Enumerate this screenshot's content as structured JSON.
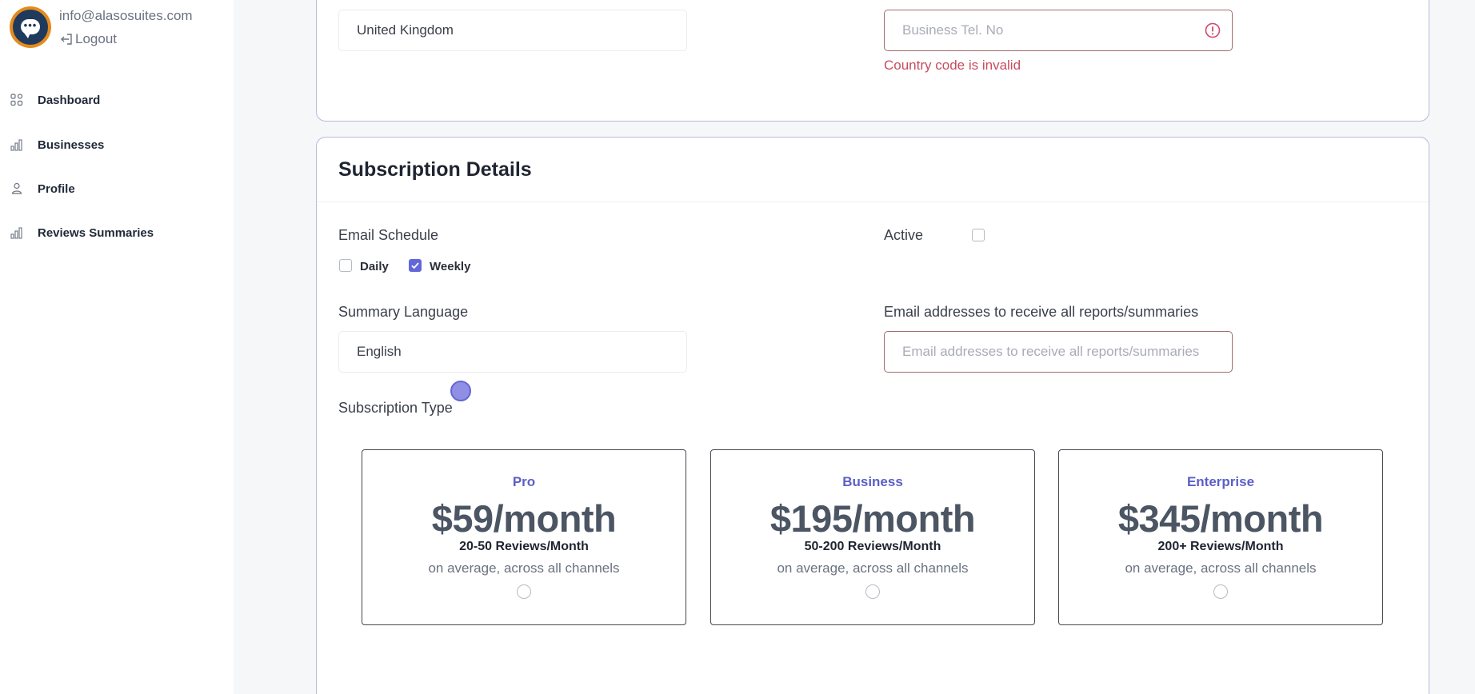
{
  "user": {
    "email": "info@alasosuites.com",
    "logout_label": "Logout"
  },
  "sidebar": {
    "items": [
      {
        "label": "Dashboard",
        "icon": "grid-icon"
      },
      {
        "label": "Businesses",
        "icon": "bar-chart-icon"
      },
      {
        "label": "Profile",
        "icon": "person-icon"
      },
      {
        "label": "Reviews Summaries",
        "icon": "bar-chart-icon"
      }
    ]
  },
  "contact": {
    "country_value": "United Kingdom",
    "tel_placeholder": "Business Tel. No",
    "tel_error": "Country code is invalid"
  },
  "subscription": {
    "title": "Subscription Details",
    "email_schedule_label": "Email Schedule",
    "daily_label": "Daily",
    "daily_checked": false,
    "weekly_label": "Weekly",
    "weekly_checked": true,
    "active_label": "Active",
    "active_checked": false,
    "summary_language_label": "Summary Language",
    "summary_language_value": "English",
    "emails_label": "Email addresses to receive all reports/summaries",
    "emails_placeholder": "Email addresses to receive all reports/summaries",
    "type_label": "Subscription Type",
    "plans": [
      {
        "name": "Pro",
        "price": "$59/month",
        "reviews": "20-50 Reviews/Month",
        "note": "on average, across all channels",
        "selected": false
      },
      {
        "name": "Business",
        "price": "$195/month",
        "reviews": "50-200 Reviews/Month",
        "note": "on average, across all channels",
        "selected": false
      },
      {
        "name": "Enterprise",
        "price": "$345/month",
        "reviews": "200+ Reviews/Month",
        "note": "on average, across all channels",
        "selected": false
      }
    ]
  },
  "colors": {
    "accent": "#6366d9",
    "plan_name": "#5b5fc7",
    "error": "#c84d5e",
    "section_border": "#b8b9df"
  }
}
